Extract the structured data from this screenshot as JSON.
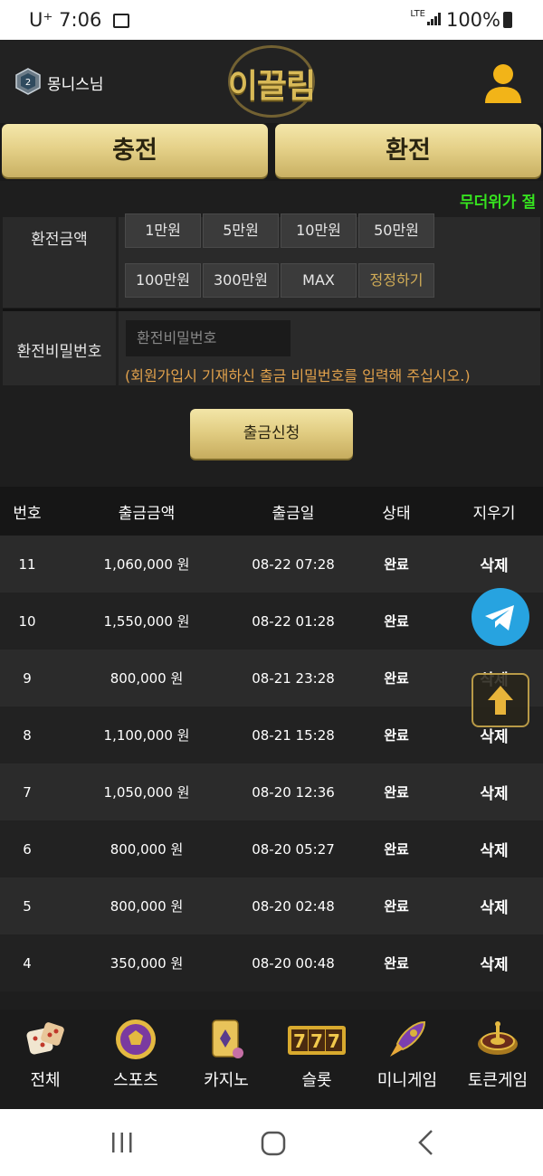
{
  "status_bar": {
    "carrier": "U⁺",
    "time": "7:06",
    "network": "LTE",
    "battery": "100%"
  },
  "header": {
    "username": "몽니스님",
    "logo_text": "이끌림"
  },
  "tabs": {
    "charge": "충전",
    "exchange": "환전"
  },
  "marquee": {
    "text": "무더위가 절"
  },
  "form": {
    "amount_label": "환전금액",
    "amount_buttons_row1": [
      "1만원",
      "5만원",
      "10만원",
      "50만원"
    ],
    "amount_buttons_row2": [
      "100만원",
      "300만원",
      "MAX",
      "정정하기"
    ],
    "password_label": "환전비밀번호",
    "password_placeholder": "환전비밀번호",
    "password_hint": "(회원가입시 기재하신 출금 비밀번호를 입력해 주십시오.)",
    "submit_label": "출금신청"
  },
  "table": {
    "headers": [
      "번호",
      "출금금액",
      "출금일",
      "상태",
      "지우기"
    ],
    "rows": [
      {
        "no": "11",
        "amount": "1,060,000 원",
        "date": "08-22 07:28",
        "status": "완료",
        "action": "삭제"
      },
      {
        "no": "10",
        "amount": "1,550,000 원",
        "date": "08-22 01:28",
        "status": "완료",
        "action": "삭제"
      },
      {
        "no": "9",
        "amount": "800,000 원",
        "date": "08-21 23:28",
        "status": "완료",
        "action": "삭제"
      },
      {
        "no": "8",
        "amount": "1,100,000 원",
        "date": "08-21 15:28",
        "status": "완료",
        "action": "삭제"
      },
      {
        "no": "7",
        "amount": "1,050,000 원",
        "date": "08-20 12:36",
        "status": "완료",
        "action": "삭제"
      },
      {
        "no": "6",
        "amount": "800,000 원",
        "date": "08-20 05:27",
        "status": "완료",
        "action": "삭제"
      },
      {
        "no": "5",
        "amount": "800,000 원",
        "date": "08-20 02:48",
        "status": "완료",
        "action": "삭제"
      },
      {
        "no": "4",
        "amount": "350,000 원",
        "date": "08-20 00:48",
        "status": "완료",
        "action": "삭제"
      }
    ]
  },
  "bottom_nav": [
    {
      "label": "전체",
      "icon": "dice-icon"
    },
    {
      "label": "스포츠",
      "icon": "soccer-ball-icon"
    },
    {
      "label": "카지노",
      "icon": "playing-cards-icon"
    },
    {
      "label": "슬롯",
      "icon": "slot-777-icon"
    },
    {
      "label": "미니게임",
      "icon": "rocket-icon"
    },
    {
      "label": "토큰게임",
      "icon": "roulette-icon"
    }
  ],
  "colors": {
    "gold": "#e5d189",
    "marquee_green": "#36e21f",
    "hint_orange": "#e2a24c",
    "background": "#1e1e1e"
  }
}
